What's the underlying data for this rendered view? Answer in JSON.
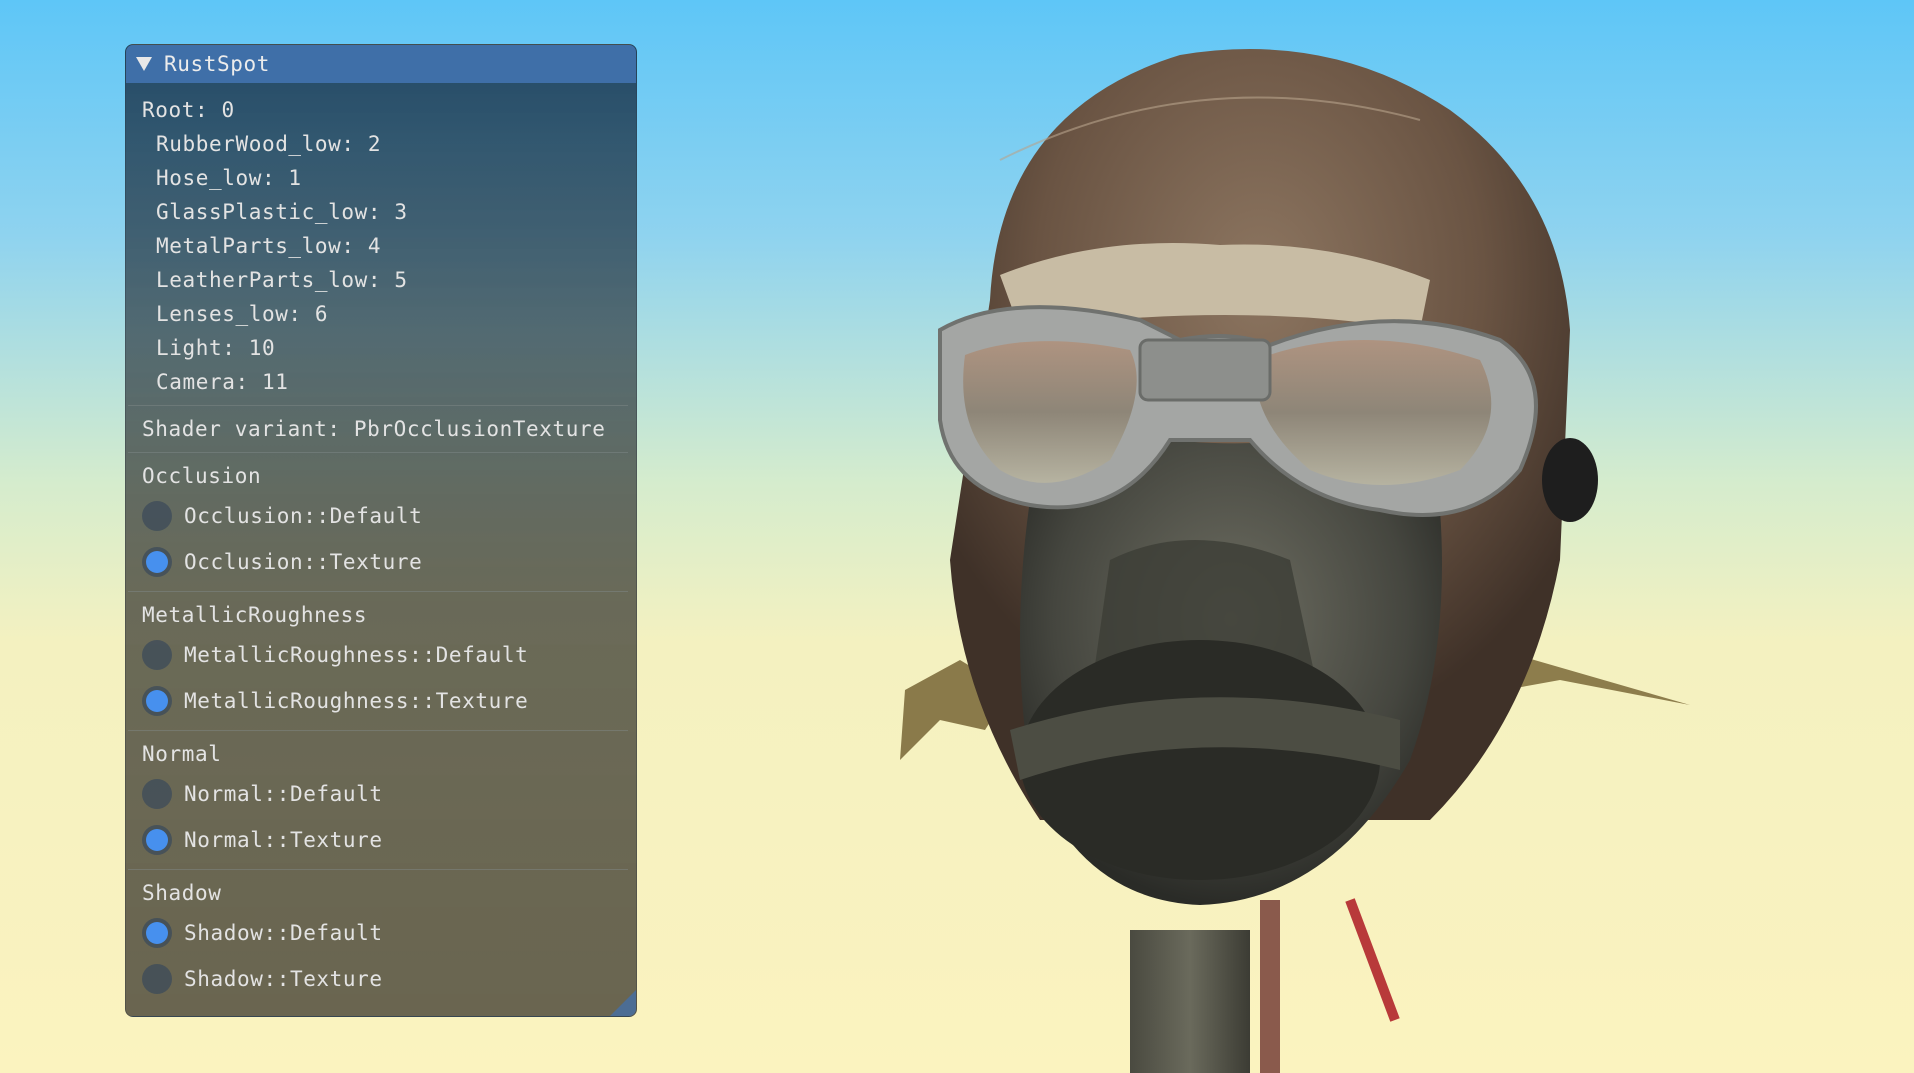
{
  "window": {
    "title": "RustSpot"
  },
  "scene_tree": {
    "root": "Root: 0",
    "children": [
      "RubberWood_low: 2",
      "Hose_low: 1",
      "GlassPlastic_low: 3",
      "MetalParts_low: 4",
      "LeatherParts_low: 5",
      "Lenses_low: 6",
      "Light: 10",
      "Camera: 11"
    ]
  },
  "shader_variant": "Shader variant: PbrOcclusionTexture",
  "groups": [
    {
      "label": "Occlusion",
      "options": [
        {
          "label": "Occlusion::Default",
          "selected": false
        },
        {
          "label": "Occlusion::Texture",
          "selected": true
        }
      ]
    },
    {
      "label": "MetallicRoughness",
      "options": [
        {
          "label": "MetallicRoughness::Default",
          "selected": false
        },
        {
          "label": "MetallicRoughness::Texture",
          "selected": true
        }
      ]
    },
    {
      "label": "Normal",
      "options": [
        {
          "label": "Normal::Default",
          "selected": false
        },
        {
          "label": "Normal::Texture",
          "selected": true
        }
      ]
    },
    {
      "label": "Shadow",
      "options": [
        {
          "label": "Shadow::Default",
          "selected": true
        },
        {
          "label": "Shadow::Texture",
          "selected": false
        }
      ]
    }
  ],
  "colors": {
    "title_bar": "#3f6fa8",
    "radio_selected": "#4790ee",
    "sky_top": "#5ec6f7",
    "sky_bottom": "#fbf3bf"
  }
}
